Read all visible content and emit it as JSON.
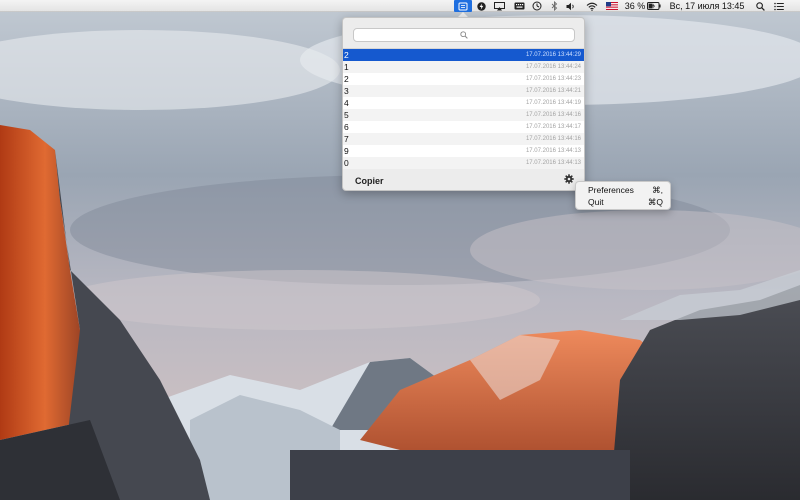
{
  "menubar": {
    "battery_percent": "36 %",
    "datetime": "Вс, 17 июля  13:45",
    "icons": [
      "copier-icon",
      "flash-icon",
      "airplay-icon",
      "keyboard-icon",
      "time-machine-icon",
      "bluetooth-icon",
      "volume-icon",
      "wifi-icon",
      "us-flag-icon",
      "battery-icon",
      "spotlight-icon",
      "notification-center-icon"
    ]
  },
  "popover": {
    "search_placeholder": "",
    "title": "Copier",
    "items": [
      {
        "text": "2",
        "time": "17.07.2016 13:44:29",
        "selected": true
      },
      {
        "text": "1",
        "time": "17.07.2016 13:44:24"
      },
      {
        "text": "2",
        "time": "17.07.2016 13:44:23"
      },
      {
        "text": "3",
        "time": "17.07.2016 13:44:21"
      },
      {
        "text": "4",
        "time": "17.07.2016 13:44:19"
      },
      {
        "text": "5",
        "time": "17.07.2016 13:44:16"
      },
      {
        "text": "6",
        "time": "17.07.2016 13:44:17"
      },
      {
        "text": "7",
        "time": "17.07.2016 13:44:16"
      },
      {
        "text": "9",
        "time": "17.07.2016 13:44:13"
      },
      {
        "text": "0",
        "time": "17.07.2016 13:44:13"
      }
    ]
  },
  "context_menu": {
    "items": [
      {
        "label": "Preferences",
        "shortcut": "⌘,"
      },
      {
        "label": "Quit",
        "shortcut": "⌘Q"
      }
    ]
  },
  "colors": {
    "selection": "#1559cf",
    "menubar_app_highlight": "#1f6fe0"
  }
}
